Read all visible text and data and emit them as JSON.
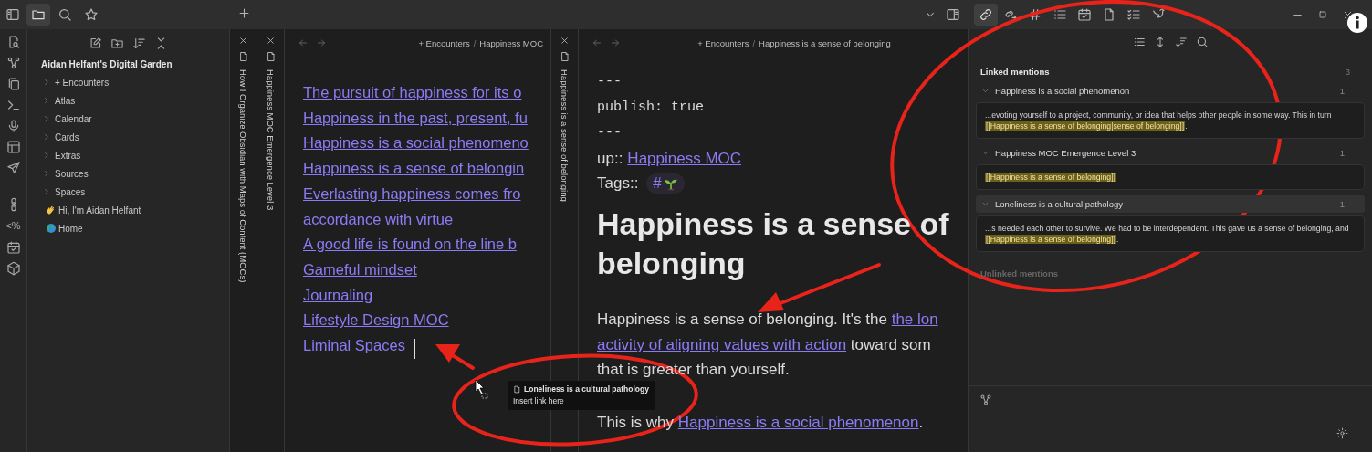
{
  "top_bar": {
    "left_tabs": [
      {
        "selected": true
      },
      {
        "selected": false
      },
      {
        "selected": false
      }
    ],
    "right_tabs": [
      {
        "selected": true
      },
      {
        "selected": false
      },
      {
        "selected": false
      },
      {
        "selected": false
      },
      {
        "selected": false
      },
      {
        "selected": false
      },
      {
        "selected": false
      },
      {
        "selected": false
      }
    ]
  },
  "ribbon": {
    "templater_label": "<%"
  },
  "file_explorer": {
    "vault_name": "Aidan Helfant's Digital Garden",
    "items": [
      {
        "kind": "folder",
        "label": "+ Encounters",
        "expanded": false
      },
      {
        "kind": "folder",
        "label": "Atlas",
        "expanded": false
      },
      {
        "kind": "folder",
        "label": "Calendar",
        "expanded": false
      },
      {
        "kind": "folder",
        "label": "Cards",
        "expanded": false
      },
      {
        "kind": "folder",
        "label": "Extras",
        "expanded": false
      },
      {
        "kind": "folder",
        "label": "Sources",
        "expanded": false
      },
      {
        "kind": "folder",
        "label": "Spaces",
        "expanded": false
      },
      {
        "kind": "note",
        "label": "Hi, I'm Aidan Helfant"
      },
      {
        "kind": "note",
        "label": "Home"
      }
    ]
  },
  "stacked_tabs": [
    {
      "title": "How I Organize Obsidian with Maps of Content (MOCs)"
    }
  ],
  "panes": [
    {
      "kind": "moc",
      "spine_title": "Happiness MOC Emergence Level 3",
      "breadcrumbs": [
        "+ Encounters",
        "Happiness MOC"
      ],
      "separator": "/",
      "links": [
        "The pursuit of happiness for its o",
        "Happiness in the past, present, fu",
        "Happiness is a social phenomeno",
        "Happiness is a sense of belongin",
        "Everlasting happiness comes fro",
        "accordance with virtue",
        "A good life is found on the line b",
        "Gameful mindset",
        "Journaling",
        "Lifestyle Design MOC",
        "Liminal Spaces"
      ]
    },
    {
      "kind": "note",
      "spine_title": "Happiness is a sense of belonging",
      "breadcrumbs": [
        "+ Encounters",
        "Happiness is a sense of belonging"
      ],
      "separator": "/",
      "frontmatter": [
        "---",
        "publish: true",
        "---"
      ],
      "up_label": "up::",
      "up_link": "Happiness MOC",
      "tags_label": "Tags::",
      "tag_hash": "#",
      "heading": "Happiness is a sense of belonging",
      "paragraphs": [
        [
          [
            {
              "kind": "text",
              "t": "Happiness is a sense of belonging. It's the "
            },
            {
              "kind": "link",
              "t": "the lon"
            }
          ],
          [
            {
              "kind": "link",
              "t": "activity of aligning values with action"
            },
            {
              "kind": "text",
              "t": " toward som"
            }
          ],
          [
            {
              "kind": "text",
              "t": "that is greater than yourself."
            }
          ]
        ],
        [
          [
            {
              "kind": "text",
              "t": "This is why "
            },
            {
              "kind": "link",
              "t": "Happiness is a social phenomenon"
            },
            {
              "kind": "text",
              "t": "."
            }
          ]
        ]
      ]
    }
  ],
  "backlinks": {
    "title": "Linked mentions",
    "count": "3",
    "groups": [
      {
        "title": "Happiness is a social phenomenon",
        "count": "1",
        "expanded": true,
        "highlighted": false,
        "snippet": {
          "before": "...evoting yourself to a project, community, or idea that helps other people in some way. This in turn ",
          "match": "[[Happiness is a sense of belonging|sense of belonging]]",
          "after": "."
        }
      },
      {
        "title": "Happiness MOC Emergence Level 3",
        "count": "1",
        "expanded": true,
        "highlighted": false,
        "snippet": {
          "match": "[[Happiness is a sense of belonging]]"
        }
      },
      {
        "title": "Loneliness is a cultural pathology",
        "count": "1",
        "expanded": true,
        "highlighted": true,
        "snippet": {
          "before": "...s needed each other to survive. We had to be interdependent. This gave us a sense of belonging, and ",
          "match": "[[Happiness is a sense of belonging]]",
          "after": "."
        }
      }
    ],
    "unlinked_title": "Unlinked mentions"
  },
  "drag_tooltip": {
    "title": "Loneliness is a cultural pathology",
    "hint": "Insert link here"
  }
}
